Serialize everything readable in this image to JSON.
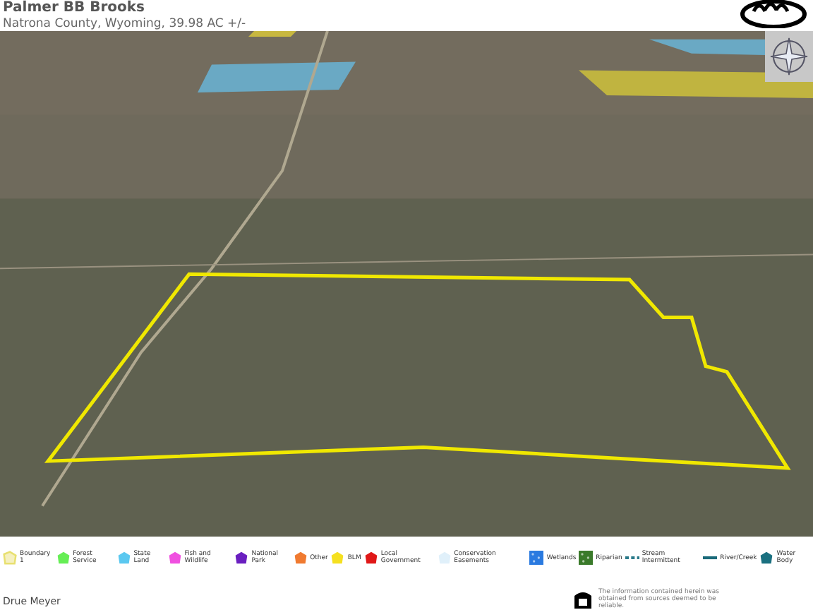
{
  "header": {
    "title": "Palmer BB Brooks",
    "subtitle": "Natrona County, Wyoming, 39.98 AC +/-"
  },
  "legend": [
    {
      "label": "Boundary 1",
      "kind": "outline",
      "color": "#e8e070"
    },
    {
      "label": "Forest Service",
      "kind": "polygon",
      "color": "#66ee55"
    },
    {
      "label": "State Land",
      "kind": "polygon",
      "color": "#5bc8f0"
    },
    {
      "label": "Fish and Wildlife",
      "kind": "polygon",
      "color": "#f050e0"
    },
    {
      "label": "National Park",
      "kind": "polygon",
      "color": "#6a1fc0"
    },
    {
      "label": "Other",
      "kind": "polygon",
      "color": "#f07a30"
    },
    {
      "label": "BLM",
      "kind": "polygon",
      "color": "#f5e020"
    },
    {
      "label": "Local Government",
      "kind": "polygon",
      "color": "#e01818"
    },
    {
      "label": "Conservation Easements",
      "kind": "polygon",
      "color": "#e0f0fa"
    },
    {
      "label": "Wetlands",
      "kind": "pattern",
      "color": "#2a7ae0"
    },
    {
      "label": "Riparian",
      "kind": "pattern",
      "color": "#3a7a2a"
    },
    {
      "label": "Stream Intermittent",
      "kind": "dashed",
      "color": "#2a7a8a"
    },
    {
      "label": "River/Creek",
      "kind": "line",
      "color": "#1a6a7a"
    },
    {
      "label": "Water Body",
      "kind": "polygon",
      "color": "#1a7080"
    }
  ],
  "footer": {
    "agent": "Drue Meyer",
    "disclaimer": "The information contained herein was obtained from sources deemed to be reliable."
  }
}
